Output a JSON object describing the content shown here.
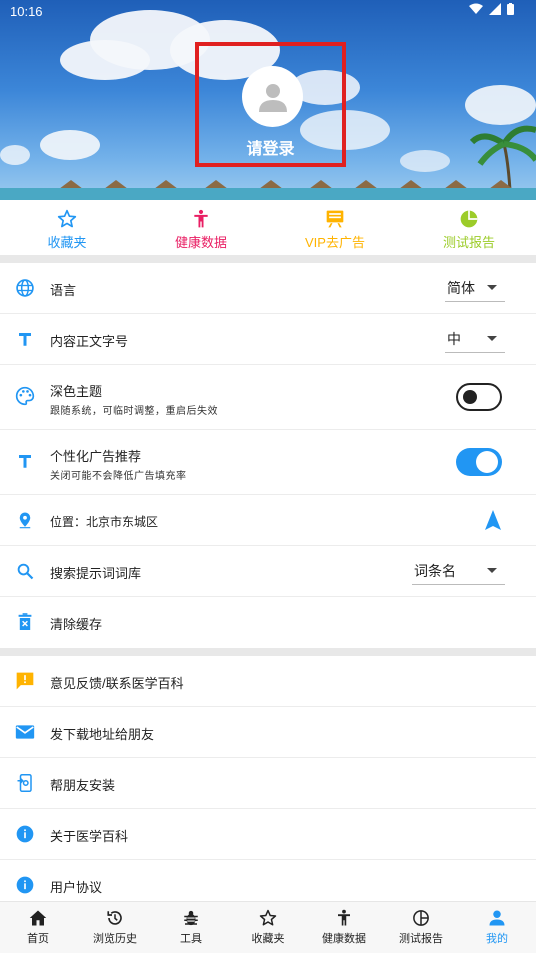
{
  "status": {
    "time": "10:16"
  },
  "header": {
    "login_label": "请登录"
  },
  "quick": [
    {
      "label": "收藏夹",
      "icon": "star-outline-icon",
      "color": "#2196f3"
    },
    {
      "label": "健康数据",
      "icon": "person-icon",
      "color": "#e91e63"
    },
    {
      "label": "VIP去广告",
      "icon": "ad-board-icon",
      "color": "#ffb300"
    },
    {
      "label": "测试报告",
      "icon": "pie-chart-icon",
      "color": "#9ccc29"
    }
  ],
  "settings": {
    "language": {
      "label": "语言",
      "value": "简体"
    },
    "font_size": {
      "label": "内容正文字号",
      "value": "中"
    },
    "dark_theme": {
      "label": "深色主题",
      "sub": "跟随系统，可临时调整，重启后失效",
      "enabled": false
    },
    "personal_ads": {
      "label": "个性化广告推荐",
      "sub": "关闭可能不会降低广告填充率",
      "enabled": true
    },
    "location": {
      "label": "位置：北京市东城区"
    },
    "search_lexicon": {
      "label": "搜索提示词词库",
      "value": "词条名"
    },
    "clear_cache": {
      "label": "清除缓存"
    }
  },
  "links": {
    "feedback": "意见反馈/联系医学百科",
    "share_link": "发下载地址给朋友",
    "help_install": "帮朋友安装",
    "about": "关于医学百科",
    "agreement": "用户协议"
  },
  "bottom_nav": [
    {
      "label": "首页",
      "icon": "home-icon"
    },
    {
      "label": "浏览历史",
      "icon": "history-icon"
    },
    {
      "label": "工具",
      "icon": "bug-icon"
    },
    {
      "label": "收藏夹",
      "icon": "star-outline-icon"
    },
    {
      "label": "健康数据",
      "icon": "person-icon"
    },
    {
      "label": "测试报告",
      "icon": "chart-circle-icon"
    },
    {
      "label": "我的",
      "icon": "account-icon",
      "active": true
    }
  ],
  "colors": {
    "accent": "#2196f3",
    "highlight_box": "#e02020",
    "divider": "#e8e8e8"
  }
}
